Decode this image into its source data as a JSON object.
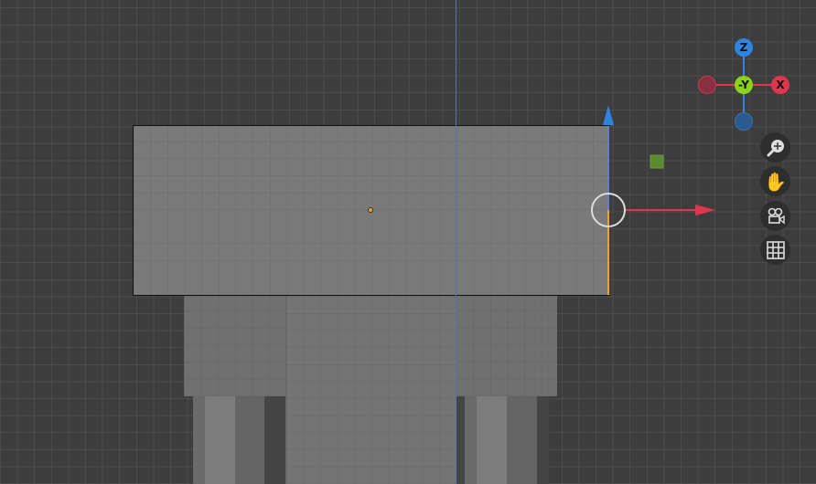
{
  "nav_gizmo": {
    "z_label": "Z",
    "y_label": "-Y",
    "x_label": "X",
    "colors": {
      "x": "#e0364d",
      "y": "#8bd21a",
      "z": "#2f84e0"
    }
  },
  "nav_buttons": [
    {
      "name": "zoom-button",
      "icon": "zoom-icon"
    },
    {
      "name": "pan-button",
      "icon": "hand-icon"
    },
    {
      "name": "camera-view-button",
      "icon": "camera-icon"
    },
    {
      "name": "ortho-toggle-button",
      "icon": "grid-icon"
    }
  ],
  "colors": {
    "origin": "#f0a030",
    "selected_object": "#5a8a30"
  }
}
